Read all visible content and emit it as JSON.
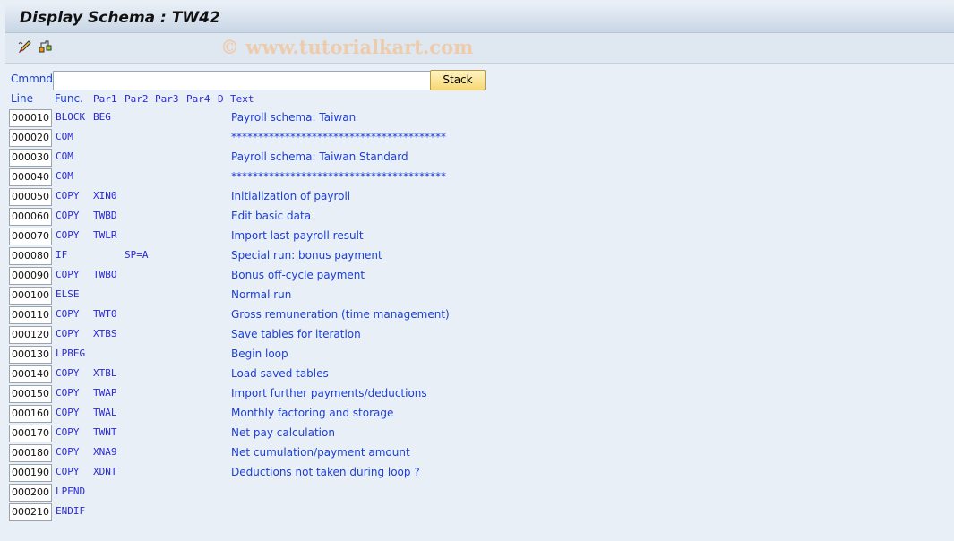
{
  "title": "Display Schema : TW42",
  "toolbar": {
    "icons": [
      "edit-pencil-icon",
      "structure-icon"
    ]
  },
  "watermark": "© www.tutorialkart.com",
  "command": {
    "label": "Cmmnd",
    "value": "",
    "button": "Stack"
  },
  "headers": {
    "line": "Line",
    "func": "Func.",
    "par1": "Par1",
    "par2": "Par2",
    "par3": "Par3",
    "par4": "Par4",
    "d": "D",
    "text": "Text"
  },
  "rows": [
    {
      "line": "000010",
      "func": "BLOCK",
      "par1": "BEG",
      "par2": "",
      "text": "Payroll schema: Taiwan"
    },
    {
      "line": "000020",
      "func": "COM",
      "par1": "",
      "par2": "",
      "text": "****************************************"
    },
    {
      "line": "000030",
      "func": "COM",
      "par1": "",
      "par2": "",
      "text": "Payroll schema: Taiwan Standard"
    },
    {
      "line": "000040",
      "func": "COM",
      "par1": "",
      "par2": "",
      "text": "****************************************"
    },
    {
      "line": "000050",
      "func": "COPY",
      "par1": "XIN0",
      "par2": "",
      "text": "Initialization of payroll"
    },
    {
      "line": "000060",
      "func": "COPY",
      "par1": "TWBD",
      "par2": "",
      "text": "Edit basic data"
    },
    {
      "line": "000070",
      "func": "COPY",
      "par1": "TWLR",
      "par2": "",
      "text": "Import last payroll result"
    },
    {
      "line": "000080",
      "func": "IF",
      "par1": "",
      "par2": "SP=A",
      "text": "Special run: bonus payment"
    },
    {
      "line": "000090",
      "func": "COPY",
      "par1": "TWBO",
      "par2": "",
      "text": "Bonus off-cycle payment"
    },
    {
      "line": "000100",
      "func": "ELSE",
      "par1": "",
      "par2": "",
      "text": "Normal run"
    },
    {
      "line": "000110",
      "func": "COPY",
      "par1": "TWT0",
      "par2": "",
      "text": "Gross remuneration (time management)"
    },
    {
      "line": "000120",
      "func": "COPY",
      "par1": "XTBS",
      "par2": "",
      "text": "Save tables for iteration"
    },
    {
      "line": "000130",
      "func": "LPBEG",
      "par1": "",
      "par2": "",
      "text": "Begin loop"
    },
    {
      "line": "000140",
      "func": "COPY",
      "par1": "XTBL",
      "par2": "",
      "text": "Load saved tables"
    },
    {
      "line": "000150",
      "func": "COPY",
      "par1": "TWAP",
      "par2": "",
      "text": "Import further payments/deductions"
    },
    {
      "line": "000160",
      "func": "COPY",
      "par1": "TWAL",
      "par2": "",
      "text": "Monthly factoring and storage"
    },
    {
      "line": "000170",
      "func": "COPY",
      "par1": "TWNT",
      "par2": "",
      "text": "Net pay calculation"
    },
    {
      "line": "000180",
      "func": "COPY",
      "par1": "XNA9",
      "par2": "",
      "text": "Net cumulation/payment amount"
    },
    {
      "line": "000190",
      "func": "COPY",
      "par1": "XDNT",
      "par2": "",
      "text": "Deductions not taken during loop ?"
    },
    {
      "line": "000200",
      "func": "LPEND",
      "par1": "",
      "par2": "",
      "text": ""
    },
    {
      "line": "000210",
      "func": "ENDIF",
      "par1": "",
      "par2": "",
      "text": ""
    }
  ]
}
